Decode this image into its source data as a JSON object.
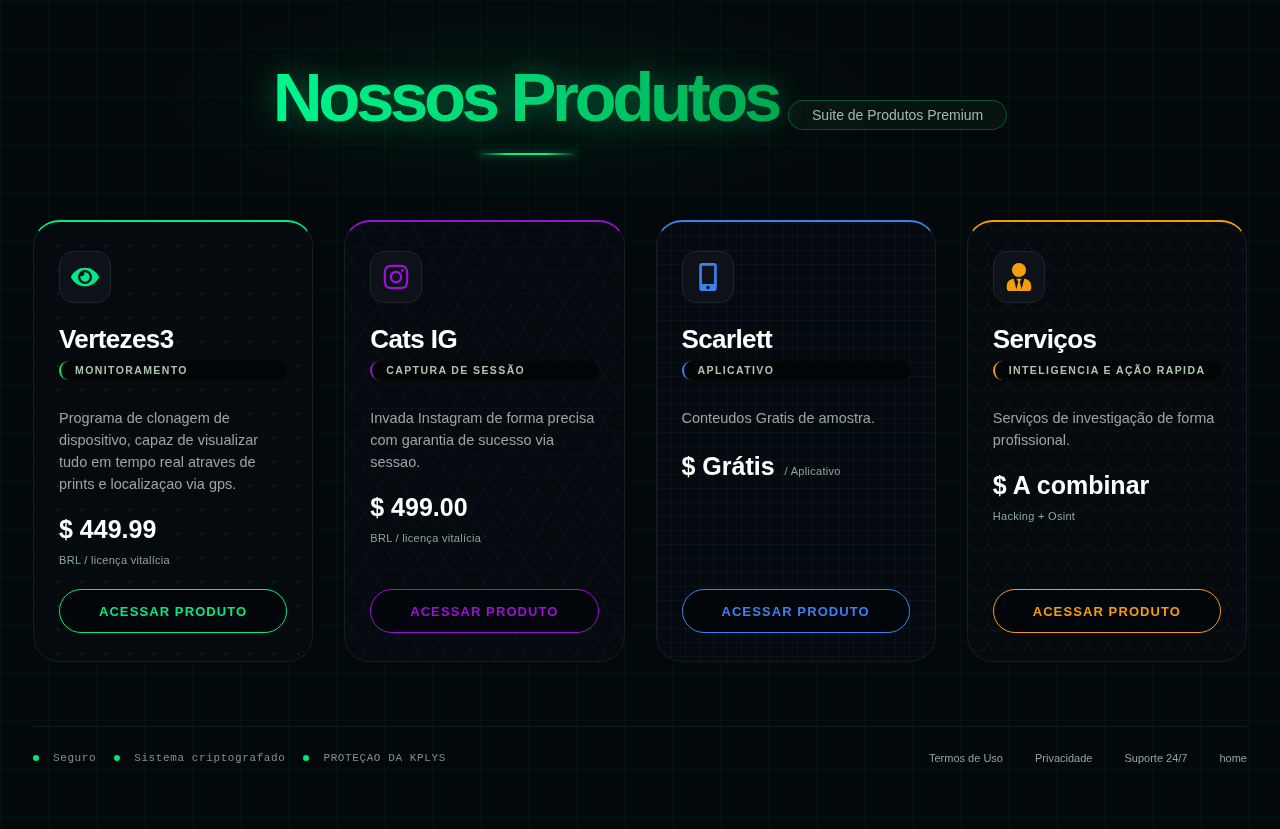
{
  "header": {
    "title": "Nossos Produtos",
    "badge": "Suite de Produtos Premium"
  },
  "products": [
    {
      "name": "Vertezes3",
      "tag": "MONITORAMENTO",
      "description": "Programa de clonagem de dispositivo, capaz de visualizar tudo em tempo real atraves de prints e localizaçao via gps.",
      "price": "$ 449.99",
      "price_note": "BRL / licença vitalícia",
      "note_inline": false,
      "button": "ACESSAR PRODUTO",
      "color": "#00e887",
      "kind": "dots"
    },
    {
      "name": "Cats IG",
      "tag": "CAPTURA DE SESSÃO",
      "description": "Invada Instagram de forma precisa com garantia de sucesso via sessao.",
      "price": "$ 499.00",
      "price_note": "BRL / licença vitalícia",
      "note_inline": false,
      "button": "ACESSAR PRODUTO",
      "color": "#9a12d6",
      "kind": "hex"
    },
    {
      "name": "Scarlett",
      "tag": "APLICATIVO",
      "description": "Conteudos Gratis de amostra.",
      "price": "$ Grátis",
      "price_note": "/ Aplicativo",
      "note_inline": true,
      "button": "ACESSAR PRODUTO",
      "color": "#3b82f0",
      "kind": "grid"
    },
    {
      "name": "Serviços",
      "tag": "INTELIGENCIA E AÇÃO RAPIDA",
      "description": "Serviços de investigação de forma profissional.",
      "price": "$ A combinar",
      "price_note": "Hacking + Osint",
      "note_inline": false,
      "button": "ACESSAR PRODUTO",
      "color": "#f59e0b",
      "kind": "waves"
    }
  ],
  "footer": {
    "status_items": [
      "Seguro",
      "Sistema criptografado",
      "PROTEÇAO DA KPLYS"
    ],
    "links": [
      "Termos de Uso",
      "Privacidade",
      "Suporte 24/7",
      "home"
    ]
  }
}
